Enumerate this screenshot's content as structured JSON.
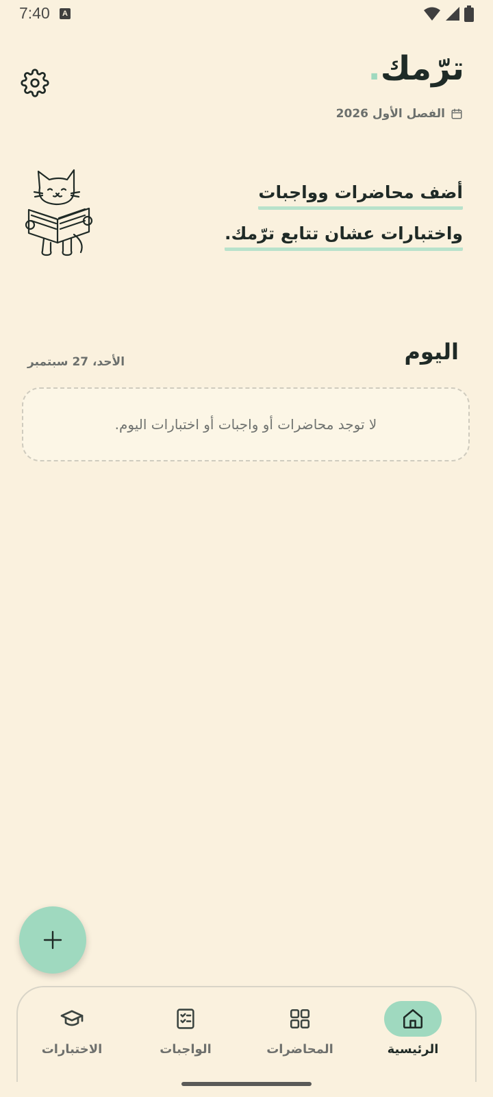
{
  "status_bar": {
    "time": "7:40",
    "indicator": "A"
  },
  "header": {
    "title": "ترّمك",
    "title_dot": ".",
    "semester": "الفصل الأول 2026",
    "settings_icon": "gear-icon",
    "calendar_icon": "calendar-icon"
  },
  "hero": {
    "line1": "أضف محاضرات وواجبات",
    "line2": "واختبارات عشان تتابع ترّمك.",
    "illustration": "cat-reading-book"
  },
  "today": {
    "title": "اليوم",
    "date": "الأحد، 27 سبتمبر",
    "empty_message": "لا توجد محاضرات أو واجبات أو اختبارات اليوم."
  },
  "fab": {
    "icon": "plus-icon"
  },
  "nav": {
    "items": [
      {
        "label": "الرئيسية",
        "icon": "home-icon",
        "active": true
      },
      {
        "label": "المحاضرات",
        "icon": "grid-icon",
        "active": false
      },
      {
        "label": "الواجبات",
        "icon": "checklist-icon",
        "active": false
      },
      {
        "label": "الاختبارات",
        "icon": "graduation-cap-icon",
        "active": false
      }
    ]
  },
  "colors": {
    "background": "#FAF1DE",
    "accent": "#9FD9BF",
    "text": "#1F2A26",
    "muted": "#6B6F6C"
  }
}
